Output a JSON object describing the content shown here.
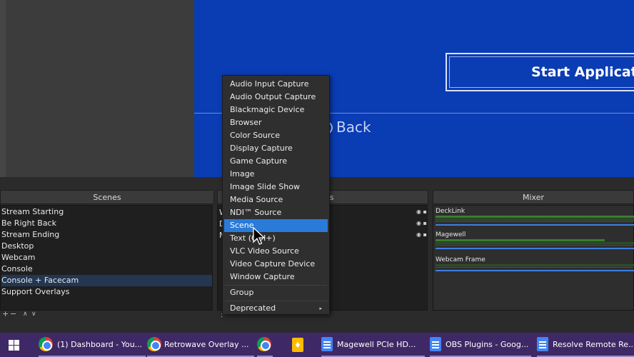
{
  "preview": {
    "start_button": "Start Application",
    "back_label": "Back"
  },
  "scenes": {
    "title": "Scenes",
    "items": [
      "Stream Starting",
      "Be Right Back",
      "Stream Ending",
      "Desktop",
      "Webcam",
      "Console",
      "Console + Facecam",
      "Support Overlays"
    ],
    "selected_index": 6,
    "toolbar": {
      "add": "+",
      "remove": "−",
      "up": "∧",
      "down": "∨"
    }
  },
  "sources": {
    "title_fragment": "es",
    "visible_letters": [
      "W",
      "D",
      "M"
    ],
    "toolbar_fragment": ":"
  },
  "mixer": {
    "title": "Mixer",
    "channels": [
      {
        "name": "DeckLink",
        "level": 1.0
      },
      {
        "name": "Magewell",
        "level": 0.85
      },
      {
        "name": "Webcam Frame",
        "level": 0.0
      }
    ]
  },
  "context_menu": {
    "items": [
      "Audio Input Capture",
      "Audio Output Capture",
      "Blackmagic Device",
      "Browser",
      "Color Source",
      "Display Capture",
      "Game Capture",
      "Image",
      "Image Slide Show",
      "Media Source",
      "NDI™ Source",
      "Scene",
      "Text (GDI+)",
      "VLC Video Source",
      "Video Capture Device",
      "Window Capture"
    ],
    "highlighted": "Scene",
    "group": "Group",
    "deprecated": "Deprecated",
    "submenu_arrow": "▸"
  },
  "taskbar": {
    "items": [
      {
        "label": "(1) Dashboard - You...",
        "icon": "chrome-icon"
      },
      {
        "label": "Retrowave Overlay ...",
        "icon": "chrome-icon"
      },
      {
        "label": "",
        "icon": "chrome-icon"
      },
      {
        "label": "",
        "icon": "keep-icon"
      },
      {
        "label": "Magewell PCIe HD...",
        "icon": "docs-icon"
      },
      {
        "label": "OBS Plugins - Goog...",
        "icon": "docs-icon"
      },
      {
        "label": "Resolve Remote Re...",
        "icon": "docs-icon"
      }
    ]
  },
  "colors": {
    "preview_blue": "#0a3cb4",
    "menu_highlight": "#2a7bd9",
    "selected_scene": "#233753",
    "taskbar": "#3f2866"
  }
}
